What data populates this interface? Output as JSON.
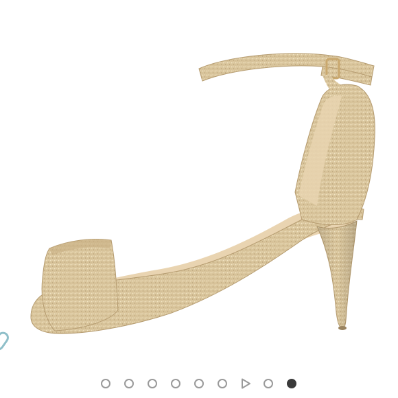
{
  "product_image": {
    "icon": "gold-glitter-ankle-strap-sandal",
    "colors": {
      "gold": "#d8c39a",
      "gold_dark": "#b79e72",
      "lining": "#ead6b5"
    }
  },
  "side_icon": {
    "icon": "link-chain-icon",
    "color": "#8fbfc9"
  },
  "carousel": {
    "slides": [
      {
        "type": "image",
        "active": false
      },
      {
        "type": "image",
        "active": false
      },
      {
        "type": "image",
        "active": false
      },
      {
        "type": "image",
        "active": false
      },
      {
        "type": "image",
        "active": false
      },
      {
        "type": "image",
        "active": false
      },
      {
        "type": "video",
        "icon": "play-icon",
        "active": false
      },
      {
        "type": "image",
        "active": false
      },
      {
        "type": "image",
        "active": true
      }
    ],
    "colors": {
      "inactive_border": "#9a9a9a",
      "active_fill": "#3a3a3a"
    }
  }
}
